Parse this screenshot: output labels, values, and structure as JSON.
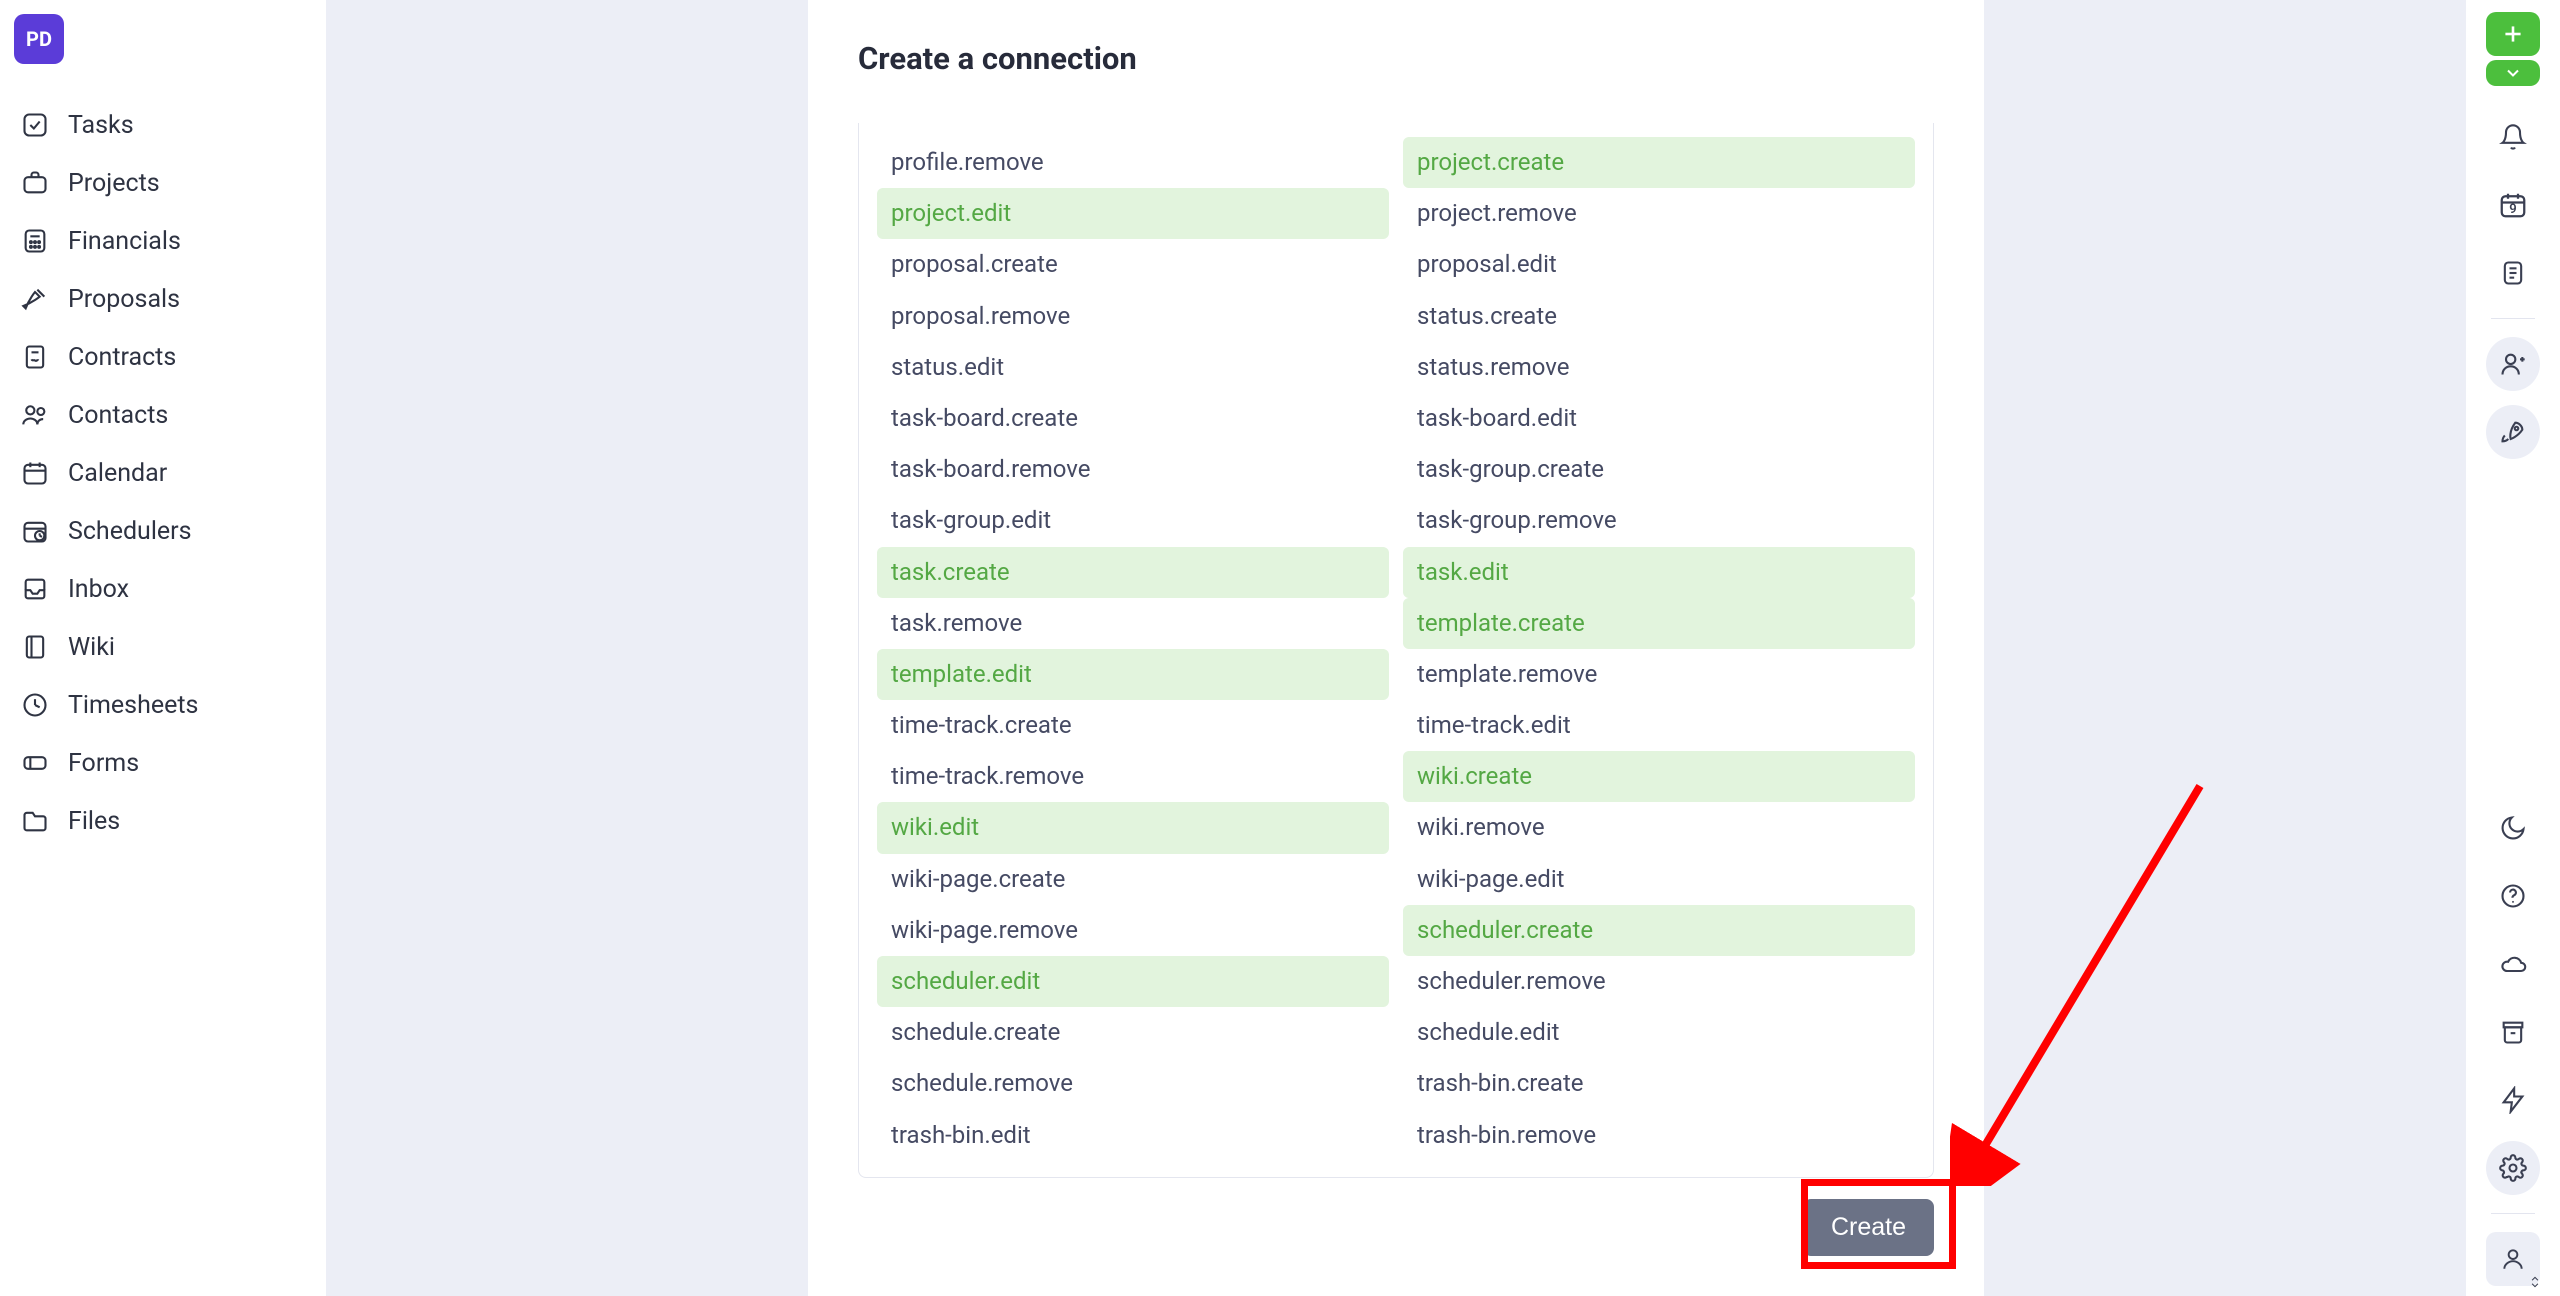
{
  "workspace": {
    "badge": "PD"
  },
  "sidebar": {
    "items": [
      {
        "label": "Tasks",
        "icon": "check-square"
      },
      {
        "label": "Projects",
        "icon": "briefcase"
      },
      {
        "label": "Financials",
        "icon": "calculator"
      },
      {
        "label": "Proposals",
        "icon": "pen-doc"
      },
      {
        "label": "Contracts",
        "icon": "file-sign"
      },
      {
        "label": "Contacts",
        "icon": "users"
      },
      {
        "label": "Calendar",
        "icon": "calendar-grid"
      },
      {
        "label": "Schedulers",
        "icon": "calendar-clock"
      },
      {
        "label": "Inbox",
        "icon": "tray"
      },
      {
        "label": "Wiki",
        "icon": "book"
      },
      {
        "label": "Timesheets",
        "icon": "clock"
      },
      {
        "label": "Forms",
        "icon": "form-field"
      },
      {
        "label": "Files",
        "icon": "folder-doc"
      }
    ]
  },
  "page": {
    "title": "Create a connection",
    "create_button": "Create"
  },
  "scopes": [
    {
      "name": "profile.remove",
      "selected": false
    },
    {
      "name": "project.create",
      "selected": true
    },
    {
      "name": "project.edit",
      "selected": true
    },
    {
      "name": "project.remove",
      "selected": false
    },
    {
      "name": "proposal.create",
      "selected": false
    },
    {
      "name": "proposal.edit",
      "selected": false
    },
    {
      "name": "proposal.remove",
      "selected": false
    },
    {
      "name": "status.create",
      "selected": false
    },
    {
      "name": "status.edit",
      "selected": false
    },
    {
      "name": "status.remove",
      "selected": false
    },
    {
      "name": "task-board.create",
      "selected": false
    },
    {
      "name": "task-board.edit",
      "selected": false
    },
    {
      "name": "task-board.remove",
      "selected": false
    },
    {
      "name": "task-group.create",
      "selected": false
    },
    {
      "name": "task-group.edit",
      "selected": false
    },
    {
      "name": "task-group.remove",
      "selected": false
    },
    {
      "name": "task.create",
      "selected": true
    },
    {
      "name": "task.edit",
      "selected": true
    },
    {
      "name": "task.remove",
      "selected": false
    },
    {
      "name": "template.create",
      "selected": true
    },
    {
      "name": "template.edit",
      "selected": true
    },
    {
      "name": "template.remove",
      "selected": false
    },
    {
      "name": "time-track.create",
      "selected": false
    },
    {
      "name": "time-track.edit",
      "selected": false
    },
    {
      "name": "time-track.remove",
      "selected": false
    },
    {
      "name": "wiki.create",
      "selected": true
    },
    {
      "name": "wiki.edit",
      "selected": true
    },
    {
      "name": "wiki.remove",
      "selected": false
    },
    {
      "name": "wiki-page.create",
      "selected": false
    },
    {
      "name": "wiki-page.edit",
      "selected": false
    },
    {
      "name": "wiki-page.remove",
      "selected": false
    },
    {
      "name": "scheduler.create",
      "selected": true
    },
    {
      "name": "scheduler.edit",
      "selected": true
    },
    {
      "name": "scheduler.remove",
      "selected": false
    },
    {
      "name": "schedule.create",
      "selected": false
    },
    {
      "name": "schedule.edit",
      "selected": false
    },
    {
      "name": "schedule.remove",
      "selected": false
    },
    {
      "name": "trash-bin.create",
      "selected": false
    },
    {
      "name": "trash-bin.edit",
      "selected": false
    },
    {
      "name": "trash-bin.remove",
      "selected": false
    }
  ],
  "right_rail": {
    "calendar_day": "9"
  },
  "colors": {
    "accent_green": "#4cbf3d",
    "brand_purple": "#5b3cd8",
    "annotation_red": "#ff0000"
  }
}
